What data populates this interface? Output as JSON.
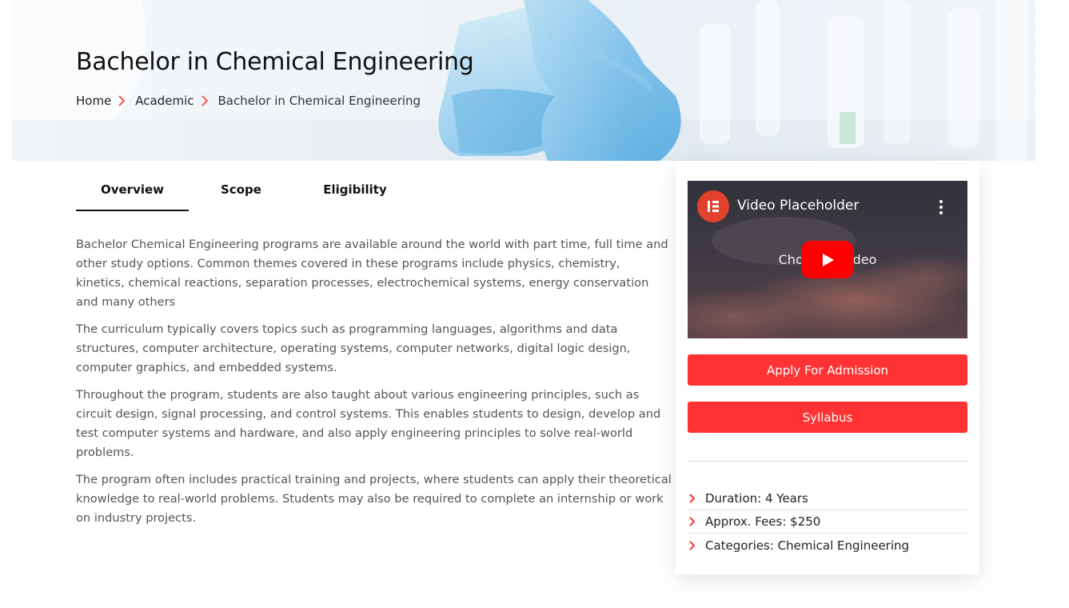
{
  "hero": {
    "title": "Bachelor in Chemical Engineering",
    "breadcrumb": [
      "Home",
      "Academic",
      "Bachelor in Chemical Engineering"
    ]
  },
  "tabs": [
    {
      "label": "Overview",
      "active": true
    },
    {
      "label": "Scope",
      "active": false
    },
    {
      "label": "Eligibility",
      "active": false
    }
  ],
  "overview": {
    "paragraphs": [
      "Bachelor Chemical Engineering programs are available around the world with part time, full time and other study options. Common themes covered in these programs include physics, chemistry, kinetics, chemical reactions, separation processes, electrochemical systems, energy conservation and many others",
      "The curriculum typically covers topics such as programming languages, algorithms and data structures, computer architecture, operating systems, computer networks, digital logic design, computer graphics, and embedded systems.",
      "Throughout the program, students are also taught about various engineering principles, such as circuit design, signal processing, and control systems. This enables students to design, develop and test computer systems and hardware, and also apply engineering principles to solve real-world problems.",
      "The program often includes practical training and projects, where students can apply their theoretical knowledge to real-world problems. Students may also be required to complete an internship or work on industry projects."
    ]
  },
  "sidebar": {
    "video": {
      "title": "Video Placeholder",
      "subtitle": "Choose a video",
      "icons": [
        "elementor-logo-icon",
        "more-vertical-icon",
        "youtube-play-icon"
      ]
    },
    "apply_label": "Apply For Admission",
    "syllabus_label": "Syllabus",
    "facts": [
      "Duration: 4 Years",
      "Approx. Fees: $250",
      "Categories: Chemical Engineering"
    ]
  },
  "colors": {
    "accent": "#ff3333",
    "text": "#222222",
    "muted_text": "#555555",
    "youtube_red": "#ff0000",
    "elementor_red": "#e2412e"
  }
}
